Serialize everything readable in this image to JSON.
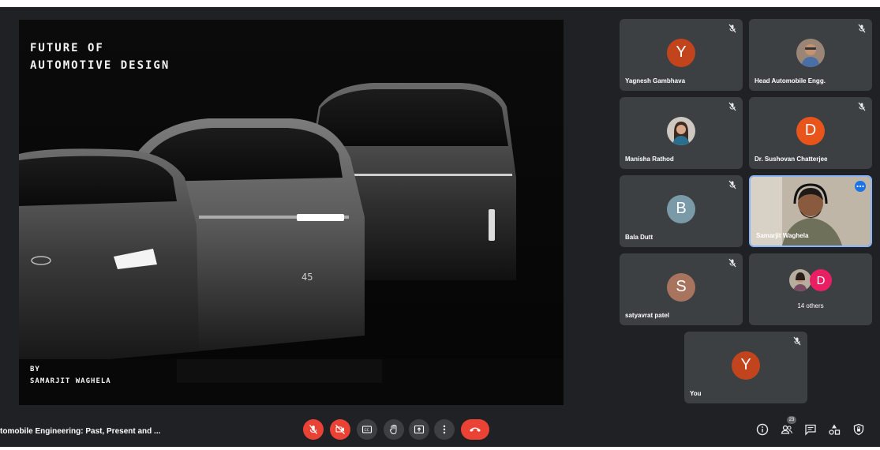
{
  "slide": {
    "title_line1": "FUTURE OF",
    "title_line2": "AUTOMOTIVE DESIGN",
    "byline1": "BY",
    "byline2": "SAMARJIT WAGHELA",
    "car_badge": "45"
  },
  "participants": [
    {
      "name": "Yagnesh Gambhava",
      "initial": "Y",
      "color": "#c1441c",
      "muted": true
    },
    {
      "name": "Head Automobile Engg.",
      "avatar": "photo",
      "muted": true
    },
    {
      "name": "Manisha Rathod",
      "avatar": "photo",
      "muted": true
    },
    {
      "name": "Dr. Sushovan Chatterjee",
      "initial": "D",
      "color": "#e8541a",
      "muted": true
    },
    {
      "name": "Bala Dutt",
      "initial": "B",
      "color": "#7b9aa8",
      "muted": true
    },
    {
      "name": "Samarjit Waghela",
      "avatar": "video",
      "active_speaker": true
    },
    {
      "name": "satyavrat patel",
      "initial": "S",
      "color": "#a8745e",
      "muted": true
    },
    {
      "name": "14 others",
      "initial": "D",
      "color": "#e91e63"
    },
    {
      "name": "You",
      "initial": "Y",
      "color": "#c1441c",
      "muted": true
    }
  ],
  "bottom_bar": {
    "meeting_title": "tomobile Engineering: Past, Present and ...",
    "people_count": "23",
    "controls": [
      "mic-off-icon",
      "camera-off-icon",
      "captions-icon",
      "raise-hand-icon",
      "present-icon",
      "more-options-icon",
      "end-call-icon"
    ],
    "right_controls": [
      "info-icon",
      "people-icon",
      "chat-icon",
      "activities-icon",
      "host-controls-icon"
    ]
  },
  "colors": {
    "background": "#202124",
    "tile": "#3c4043",
    "danger": "#ea4335",
    "active": "#8ab4f8"
  }
}
